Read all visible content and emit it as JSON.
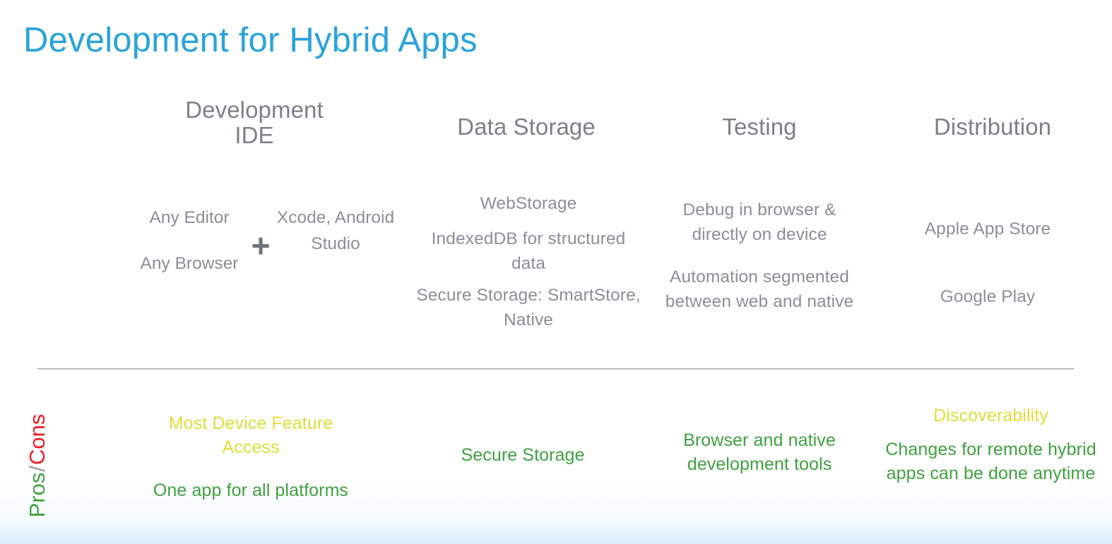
{
  "slide": {
    "title": "Development for Hybrid Apps"
  },
  "columns": {
    "ide": {
      "header_line1": "Development",
      "header_line2": "IDE",
      "left_item1": "Any Editor",
      "left_item2": "Any Browser",
      "plus_symbol": "+",
      "right_item": "Xcode, Android Studio"
    },
    "storage": {
      "header": "Data Storage",
      "item1": "WebStorage",
      "item2": "IndexedDB for structured data",
      "item3": "Secure Storage: SmartStore, Native"
    },
    "testing": {
      "header": "Testing",
      "item1": "Debug in browser & directly on device",
      "item2": "Automation segmented between web and native"
    },
    "distribution": {
      "header": "Distribution",
      "item1": "Apple App Store",
      "item2": "Google Play"
    }
  },
  "pros_cons": {
    "label_pros": "Pros",
    "label_separator": "/",
    "label_cons": "Cons",
    "ide": {
      "con": "Most Device Feature Access",
      "pro": "One app for all platforms"
    },
    "storage": {
      "pro": "Secure Storage"
    },
    "testing": {
      "pro": "Browser and native development tools"
    },
    "distribution": {
      "con": "Discoverability",
      "pro": "Changes for remote hybrid apps can be done anytime"
    }
  },
  "colors": {
    "title_blue": "#29a3dc",
    "header_gray": "#7b8187",
    "body_gray": "#8a9096",
    "pro_green": "#3fa13f",
    "con_yellow": "#e3dc3a",
    "cons_red": "#ee1c25",
    "divider_gray": "#a7a9ac"
  }
}
